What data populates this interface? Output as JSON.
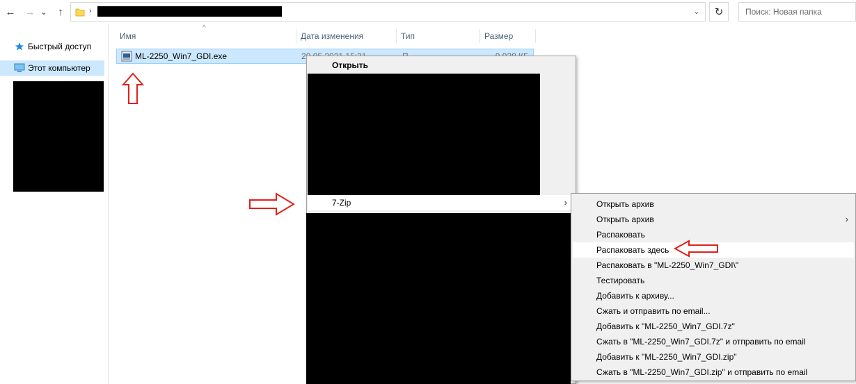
{
  "nav": {
    "back_icon": "arrow-left-icon",
    "forward_icon": "arrow-right-icon",
    "recent_icon": "chevron-down-icon",
    "up_icon": "arrow-up-icon",
    "back_glyph": "←",
    "forward_glyph": "→",
    "recent_glyph": "⌄",
    "up_glyph": "↑"
  },
  "address": {
    "breadcrumb_sep": "›",
    "dropdown_glyph": "⌄",
    "refresh_glyph": "↻"
  },
  "search": {
    "placeholder": "Поиск: Новая папка"
  },
  "sidebar": {
    "items": [
      {
        "label": "Быстрый доступ",
        "icon": "star-icon",
        "selected": false
      },
      {
        "label": "Этот компьютер",
        "icon": "computer-icon",
        "selected": true
      }
    ]
  },
  "columns": {
    "name": "Имя",
    "date": "Дата изменения",
    "type": "Тип",
    "size": "Размер"
  },
  "file": {
    "name": "ML-2250_Win7_GDI.exe",
    "date": "20.05.2021 15:31",
    "type": "П",
    "size": "9 938 КБ",
    "icon": "installer-icon"
  },
  "context_menu": {
    "open": "Открыть",
    "sevenzip": "7-Zip",
    "submenu_glyph": "›"
  },
  "submenu": {
    "items": [
      {
        "label": "Открыть архив",
        "has_arrow": false,
        "hover": false
      },
      {
        "label": "Открыть архив",
        "has_arrow": true,
        "hover": false
      },
      {
        "label": "Распаковать",
        "has_arrow": false,
        "hover": false
      },
      {
        "label": "Распаковать здесь",
        "has_arrow": false,
        "hover": true
      },
      {
        "label": "Распаковать в \"ML-2250_Win7_GDI\\\"",
        "has_arrow": false,
        "hover": false
      },
      {
        "label": "Тестировать",
        "has_arrow": false,
        "hover": false
      },
      {
        "label": "Добавить к архиву...",
        "has_arrow": false,
        "hover": false
      },
      {
        "label": "Сжать и отправить по email...",
        "has_arrow": false,
        "hover": false
      },
      {
        "label": "Добавить к \"ML-2250_Win7_GDI.7z\"",
        "has_arrow": false,
        "hover": false
      },
      {
        "label": "Сжать в \"ML-2250_Win7_GDI.7z\" и отправить по email",
        "has_arrow": false,
        "hover": false
      },
      {
        "label": "Добавить к \"ML-2250_Win7_GDI.zip\"",
        "has_arrow": false,
        "hover": false
      },
      {
        "label": "Сжать в \"ML-2250_Win7_GDI.zip\" и отправить по email",
        "has_arrow": false,
        "hover": false
      }
    ]
  },
  "colors": {
    "selection_bg": "#cce8ff",
    "selection_border": "#99d1ff",
    "menu_bg": "#f0f0f0",
    "annotation_arrow": "#e0201b",
    "redaction": "#000000"
  }
}
